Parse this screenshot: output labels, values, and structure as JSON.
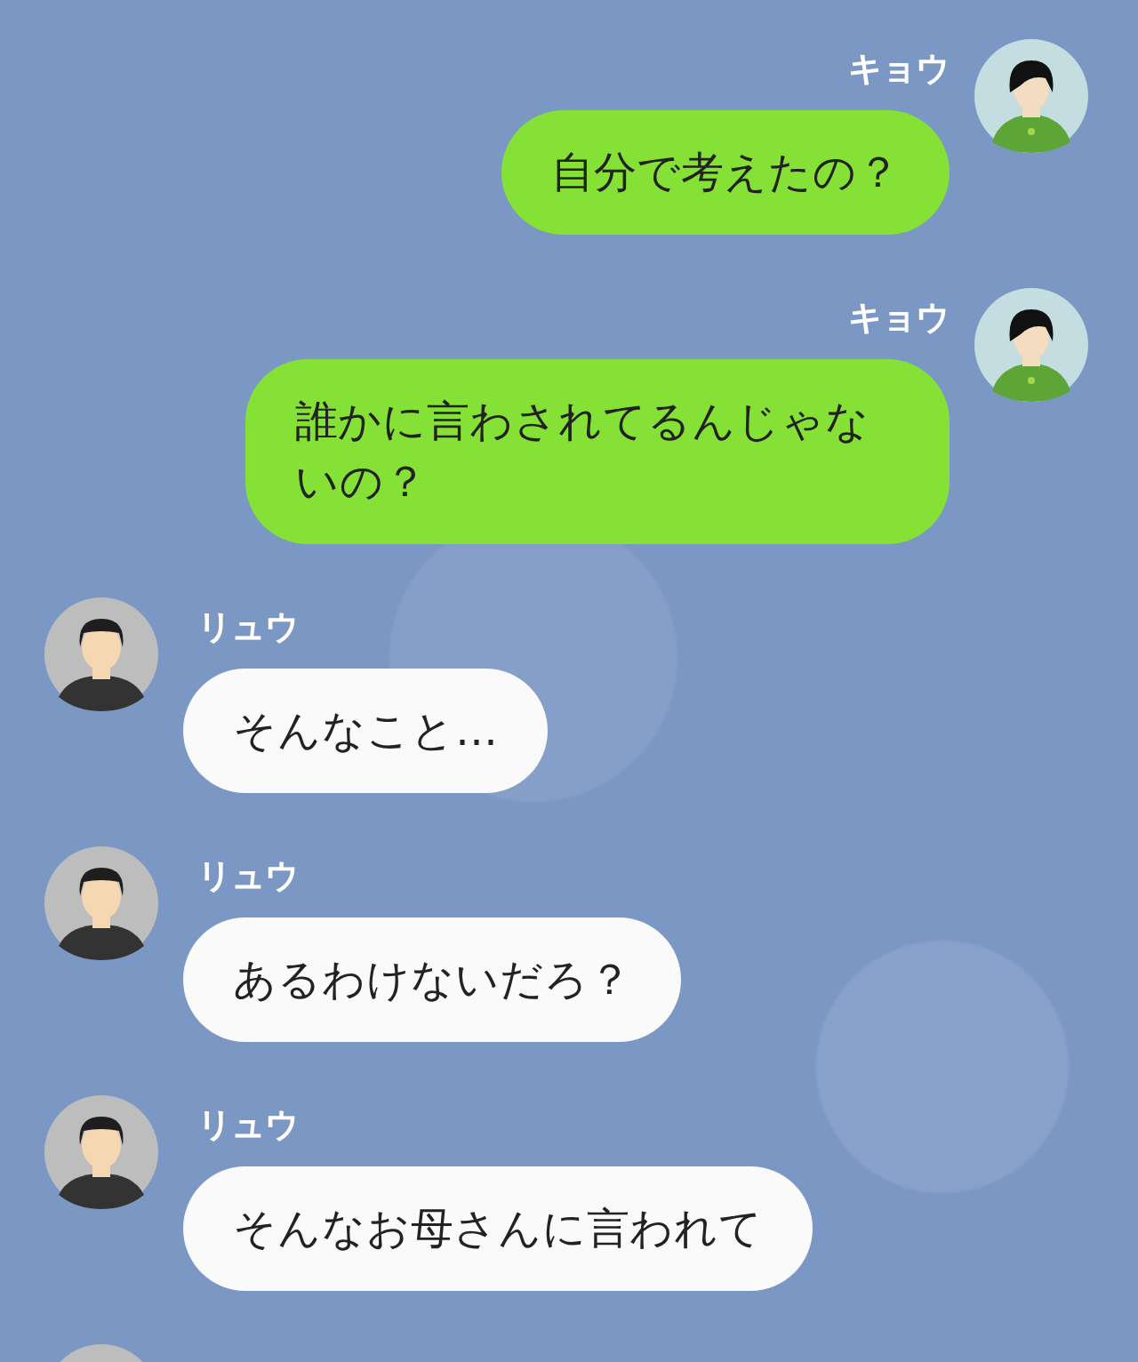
{
  "messages": [
    {
      "kind": "sent",
      "name": "キョウ",
      "text": "自分で考えたの？"
    },
    {
      "kind": "sent",
      "name": "キョウ",
      "text": "誰かに言わされてるんじゃないの？"
    },
    {
      "kind": "received",
      "name": "リュウ",
      "text": "そんなこと…"
    },
    {
      "kind": "received",
      "name": "リュウ",
      "text": "あるわけないだろ？"
    },
    {
      "kind": "received",
      "name": "リュウ",
      "text": "そんなお母さんに言われて"
    },
    {
      "kind": "received"
    }
  ]
}
